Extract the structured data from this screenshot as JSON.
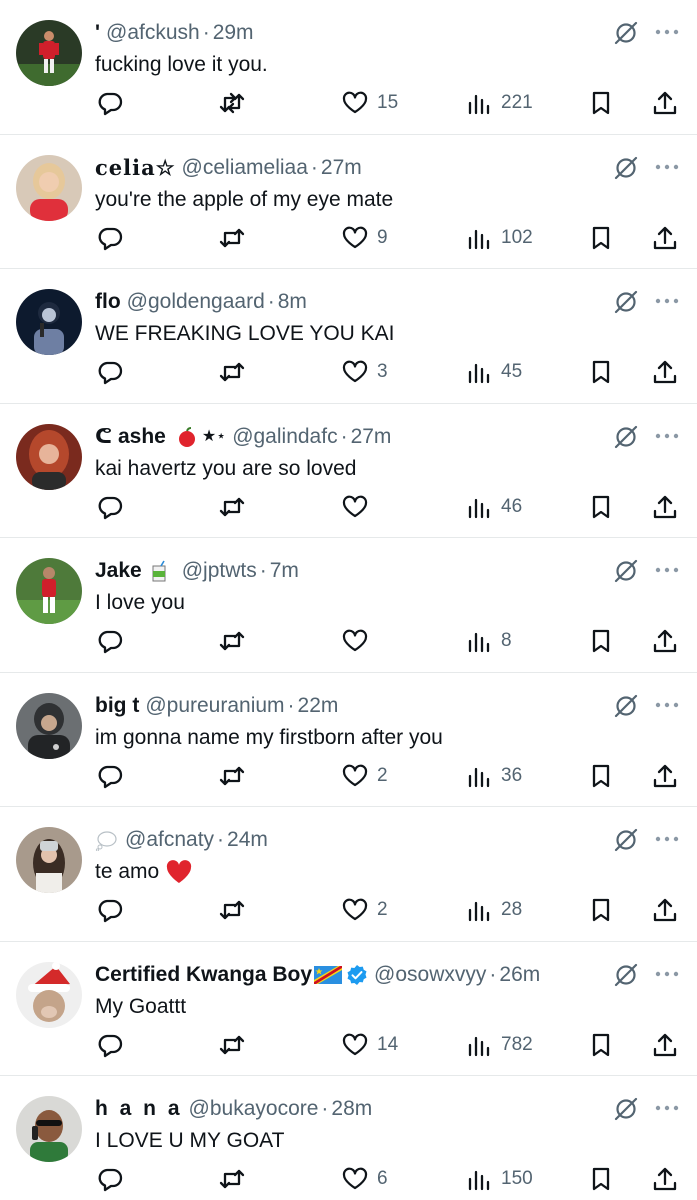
{
  "colors": {
    "text": "#0f1419",
    "muted": "#536471",
    "divider": "#e6e9ea",
    "verified": "#1d9bf0",
    "heart_emoji": "#e0242d"
  },
  "tweets": [
    {
      "name": "'",
      "handle": "@afckush",
      "dot": "·",
      "time": "29m",
      "text": "fucking love it you.",
      "likes": "15",
      "views": "221",
      "avatar_icon": "footballer-red-kit-avatar"
    },
    {
      "name": "celia☆",
      "handle": "@celiameliaa",
      "dot": "·",
      "time": "27m",
      "text": "you're the apple of my eye mate",
      "likes": "9",
      "views": "102",
      "avatar_icon": "blonde-woman-avatar"
    },
    {
      "name": "flo",
      "handle": "@goldengaard",
      "dot": "·",
      "time": "8m",
      "text": "WE FREAKING LOVE YOU KAI",
      "likes": "3",
      "views": "45",
      "avatar_icon": "singer-on-stage-avatar"
    },
    {
      "name": "ᕦ ashe",
      "name_suffix": "★⋆",
      "handle": "@galindafc",
      "dot": "·",
      "time": "27m",
      "text": "kai havertz you are so loved",
      "likes": "",
      "views": "46",
      "avatar_icon": "red-haired-woman-avatar",
      "emoji": "apple-emoji-icon"
    },
    {
      "name": "Jake",
      "handle": "@jptwts",
      "dot": "·",
      "time": "7m",
      "text": "I love you",
      "likes": "",
      "views": "8",
      "avatar_icon": "footballer-pitch-avatar",
      "emoji": "juice-box-emoji-icon"
    },
    {
      "name": "big t",
      "handle": "@pureuranium",
      "dot": "·",
      "time": "22m",
      "text": "im gonna name my firstborn after you",
      "likes": "2",
      "views": "36",
      "avatar_icon": "man-in-hoodie-avatar"
    },
    {
      "name": "",
      "handle": "@afcnaty",
      "dot": "·",
      "time": "24m",
      "text": "te amo",
      "likes": "2",
      "views": "28",
      "avatar_icon": "girl-mirror-selfie-avatar",
      "emoji": "thought-balloon-emoji-icon",
      "text_emoji": "red-heart-emoji-icon"
    },
    {
      "name": "Certified Kwanga Boy",
      "handle": "@osowxvyy",
      "dot": "·",
      "time": "26m",
      "text": "My Goattt",
      "likes": "14",
      "views": "782",
      "avatar_icon": "dog-santa-hat-avatar",
      "emoji": "dr-congo-flag-icon",
      "verified": true
    },
    {
      "name": "h a n a",
      "handle": "@bukayocore",
      "dot": "·",
      "time": "28m",
      "text": "I LOVE U MY GOAT",
      "likes": "6",
      "views": "150",
      "avatar_icon": "man-sunglasses-phone-avatar"
    }
  ]
}
